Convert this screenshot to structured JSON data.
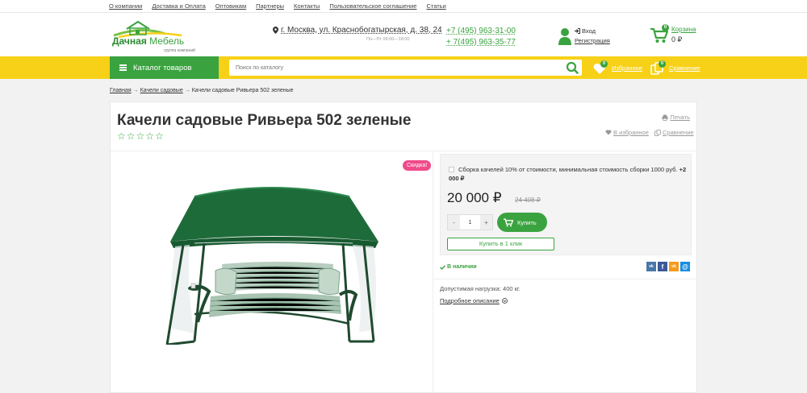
{
  "top_links": [
    "О компании",
    "Доставка и Оплата",
    "Оптовикам",
    "Партнеры",
    "Контакты",
    "Пользовательское соглашение",
    "Статьи"
  ],
  "logo": {
    "name_bold": "Дачная",
    "name_light": "Мебель",
    "tagline": "группа компаний"
  },
  "address": "г. Москва, ул. Краснобогатырская, д. 38, 24",
  "hours": "Пн—Пт 09:00—18:00",
  "phones": [
    "+7 (495) 963-31-00",
    "+ 7(495) 963-35-77"
  ],
  "user": {
    "login": "Вход",
    "register": "Регистрация"
  },
  "cart": {
    "label": "Корзина",
    "sum": "0 ₽",
    "count": "0"
  },
  "catalog_label": "Каталог товаров",
  "search_placeholder": "Поиск по каталогу",
  "favorites": {
    "label": "Избранное",
    "count": "0"
  },
  "compare": {
    "label": "Сравнение",
    "count": "0"
  },
  "breadcrumb": {
    "home": "Главная",
    "category": "Качели садовые",
    "current": "Качели садовые Ривьера 502 зеленые",
    "separator": "→"
  },
  "product": {
    "title": "Качели садовые Ривьера 502 зеленые",
    "rating_stars": 5,
    "print": "Печать",
    "to_favorites": "В избранное",
    "to_compare": "Сравнение",
    "discount_badge": "Скидка!",
    "assembly_text": "Сборка качелей 10% от стоимости, минимальная стоимость сборки 1000 руб.",
    "assembly_price_part1": "+2",
    "assembly_price_part2": "000 ₽",
    "price": "20 000 ₽",
    "old_price": "24 408 ₽",
    "qty_minus": "-",
    "quantity": "1",
    "qty_plus": "+",
    "buy": "Купить",
    "one_click": "Купить в 1 клик",
    "in_stock": "В наличии",
    "load_text": "Допустимая нагрузка: 400 кг.",
    "details": "Подробное описание"
  },
  "share": [
    {
      "icon": "vk-icon",
      "glyph": "vk",
      "color": "#4a76a8"
    },
    {
      "icon": "facebook-icon",
      "glyph": "f",
      "color": "#3b5998"
    },
    {
      "icon": "odnoklassniki-icon",
      "glyph": "ok",
      "color": "#f59b1c"
    },
    {
      "icon": "moimir-icon",
      "glyph": "@",
      "color": "#168de2"
    }
  ],
  "colors": {
    "green": "#3aa33f",
    "yellow": "#f7d117",
    "pink": "#f04b8a",
    "canopy": "#1e6b3a"
  }
}
